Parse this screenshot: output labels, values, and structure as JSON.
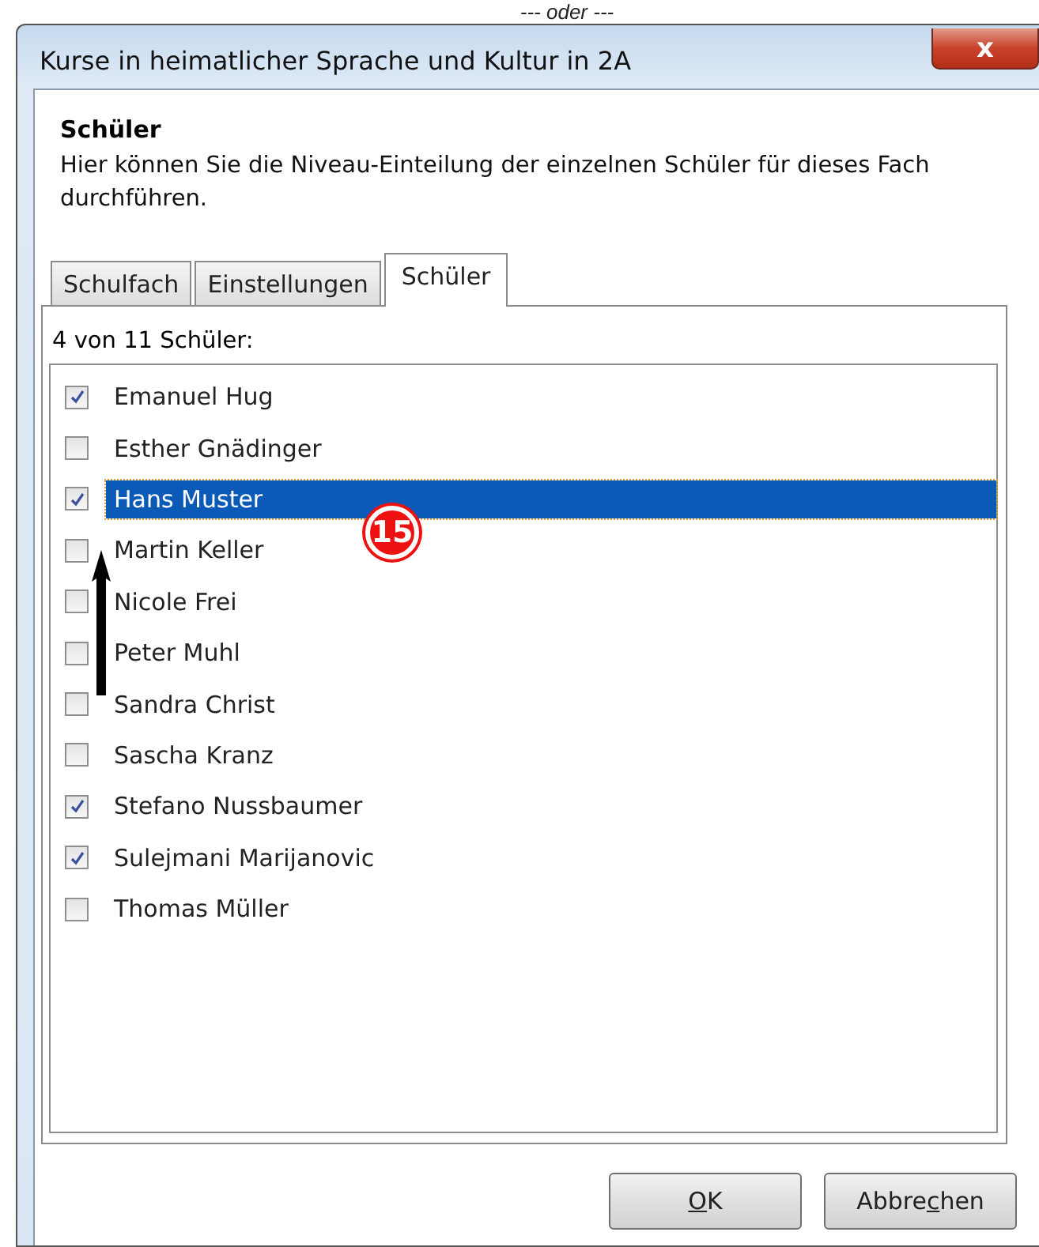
{
  "annotations": {
    "caption": "--- oder ---",
    "badge": "15"
  },
  "window": {
    "title": "Kurse in heimatlicher Sprache und Kultur in 2A",
    "close": "x"
  },
  "header": {
    "title": "Schüler",
    "description": "Hier können Sie die Niveau-Einteilung der einzelnen Schüler für dieses Fach durchführen."
  },
  "tabs": [
    {
      "label": "Schulfach",
      "selected": false
    },
    {
      "label": "Einstellungen",
      "selected": false
    },
    {
      "label": "Schüler",
      "selected": true
    }
  ],
  "count_label": "4 von 11 Schüler:",
  "students": [
    {
      "name": "Emanuel Hug",
      "checked": true,
      "selected": false
    },
    {
      "name": "Esther Gnädinger",
      "checked": false,
      "selected": false
    },
    {
      "name": "Hans Muster",
      "checked": true,
      "selected": true
    },
    {
      "name": "Martin Keller",
      "checked": false,
      "selected": false
    },
    {
      "name": "Nicole Frei",
      "checked": false,
      "selected": false
    },
    {
      "name": "Peter Muhl",
      "checked": false,
      "selected": false
    },
    {
      "name": "Sandra Christ",
      "checked": false,
      "selected": false
    },
    {
      "name": "Sascha Kranz",
      "checked": false,
      "selected": false
    },
    {
      "name": "Stefano Nussbaumer",
      "checked": true,
      "selected": false
    },
    {
      "name": "Sulejmani Marijanovic",
      "checked": true,
      "selected": false
    },
    {
      "name": "Thomas Müller",
      "checked": false,
      "selected": false
    }
  ],
  "buttons": [
    {
      "label_parts": [
        {
          "text": "O",
          "underlined": true
        },
        {
          "text": "K",
          "underlined": false
        }
      ]
    },
    {
      "label_parts": [
        {
          "text": "Abbre",
          "underlined": false
        },
        {
          "text": "c",
          "underlined": true
        },
        {
          "text": "hen",
          "underlined": false
        }
      ]
    }
  ]
}
